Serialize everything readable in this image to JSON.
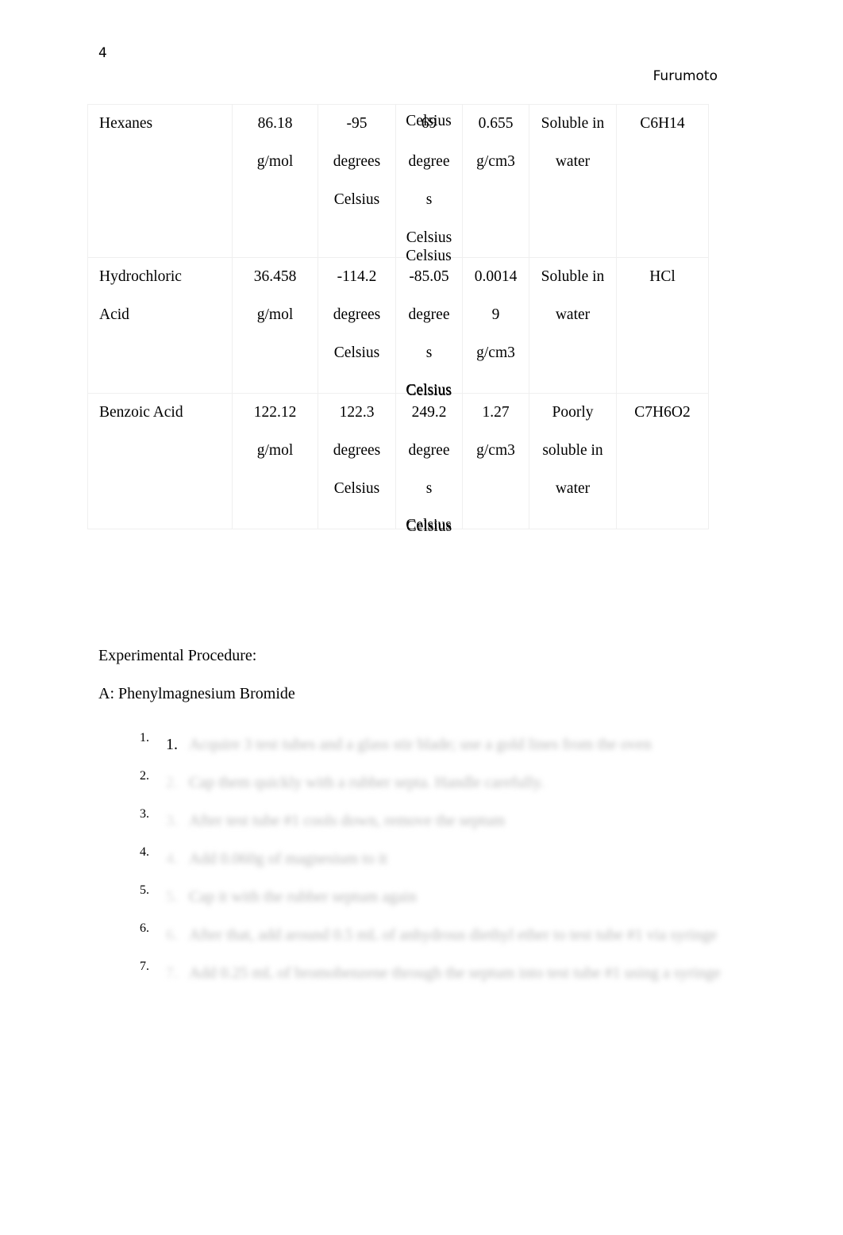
{
  "document": {
    "page_number": "4",
    "running_header": "Furumoto"
  },
  "table": {
    "rows": [
      {
        "name": [
          "Hexanes"
        ],
        "molar_mass": [
          "86.18",
          "g/mol"
        ],
        "melting_point": [
          "-95",
          "degrees",
          "Celsius"
        ],
        "boiling_point": [
          "69",
          "degree",
          "s",
          "Celsius"
        ],
        "density": [
          "0.655",
          "g/cm3"
        ],
        "solubility": [
          "Soluble in",
          "water"
        ],
        "formula": [
          "C6H14"
        ]
      },
      {
        "name": [
          "Hydrochloric",
          "Acid"
        ],
        "molar_mass": [
          "36.458",
          "g/mol"
        ],
        "melting_point": [
          "-114.2",
          "degrees",
          "Celsius"
        ],
        "boiling_point": [
          "-85.05",
          "degree",
          "s",
          "Celsius"
        ],
        "density": [
          "0.0014",
          "9",
          "g/cm3"
        ],
        "solubility": [
          "Soluble in",
          "water"
        ],
        "formula": [
          "HCl"
        ]
      },
      {
        "name": [
          "Benzoic Acid"
        ],
        "molar_mass": [
          "122.12",
          "g/mol"
        ],
        "melting_point": [
          "122.3",
          "degrees",
          "Celsius"
        ],
        "boiling_point": [
          "249.2",
          "degree",
          "s",
          "Celsius"
        ],
        "density": [
          "1.27",
          "g/cm3"
        ],
        "solubility": [
          "Poorly",
          "soluble in",
          "water"
        ],
        "formula": [
          "C7H6O2"
        ]
      }
    ],
    "overflow_above_row": [
      "Celsius",
      "Celsius",
      "Celsius"
    ],
    "overflow_below_table": "Celsius"
  },
  "sections": {
    "experimental_procedure_heading": "Experimental Procedure:",
    "part_a_heading": "A: Phenylmagnesium Bromide"
  },
  "procedure": {
    "items": [
      {
        "marker": "1.",
        "text": "Acquire 3 test tubes and a glass stir blade; use a gold lines from the oven",
        "redacted": true
      },
      {
        "marker": "2.",
        "text": "Cap them quickly with a rubber septa. Handle carefully.",
        "redacted": true
      },
      {
        "marker": "3.",
        "text": "After test tube #1 cools down, remove the septum",
        "redacted": true
      },
      {
        "marker": "4.",
        "text": "Add 0.060g of magnesium to it",
        "redacted": true
      },
      {
        "marker": "5.",
        "text": "Cap it with the rubber septum again",
        "redacted": true
      },
      {
        "marker": "6.",
        "text": "After that, add around 0.5 mL of anhydrous diethyl ether to test tube #1 via syringe",
        "redacted": true
      },
      {
        "marker": "7.",
        "text": "Add 0.25 mL of bromobenzene through the septum into test tube #1 using a syringe",
        "redacted": true
      }
    ]
  },
  "colors": {
    "text": "#000000",
    "table_border": "#efefef",
    "redacted_text": "#b9b9b9",
    "background": "#ffffff"
  }
}
